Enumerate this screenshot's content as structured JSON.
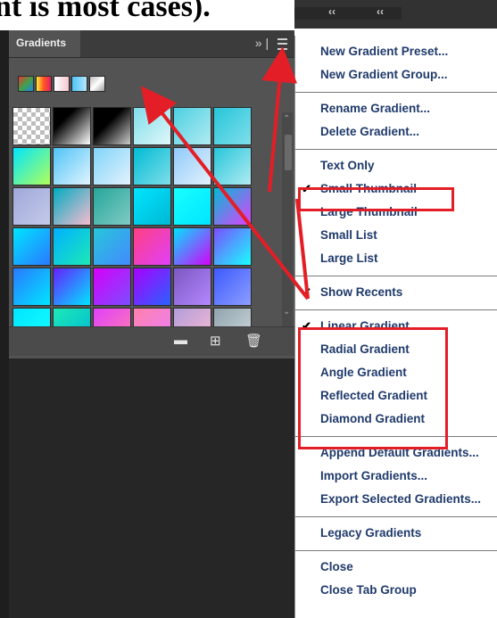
{
  "caption": "nt is most cases).",
  "panel": {
    "tab_label": "Gradients",
    "expand_glyph": "»",
    "divider_glyph": "|",
    "recents": [
      "linear-gradient(135deg,#e53935,#43a047,#1e88e5)",
      "linear-gradient(90deg,#ffeb3b,#ff5722,#e91e63)",
      "linear-gradient(90deg,#ffffff,#f5c6d0)",
      "linear-gradient(90deg,#4fc3f7,#b3e5fc)",
      "linear-gradient(135deg,#bdbdbd,#ffffff,#9e9e9e)"
    ],
    "swatches": [
      "repeating-conic-gradient(#bdbdbd 0 25%, #ffffff 0 50%) 0 0/10px 10px",
      "linear-gradient(135deg,#000 30%,#fff)",
      "linear-gradient(135deg,#000 40%,#ccc)",
      "linear-gradient(135deg,#80deea,#e0f7fa)",
      "linear-gradient(135deg,#4dd0e1,#b2ebf2)",
      "linear-gradient(135deg,#26c6da,#80deea)",
      "linear-gradient(135deg,#00e5ff,#b2ff59)",
      "linear-gradient(135deg,#4fc3f7,#e1f5fe)",
      "linear-gradient(135deg,#81d4fa,#e3f2fd)",
      "linear-gradient(135deg,#00bcd4,#80deea)",
      "linear-gradient(135deg,#90caf9,#e3f2fd)",
      "linear-gradient(135deg,#26c6da,#b2ebf2)",
      "linear-gradient(135deg,#9fa8da,#c5cae9)",
      "linear-gradient(135deg,#00acc1,#f8bbd0)",
      "linear-gradient(135deg,#26a69a,#80cbc4)",
      "linear-gradient(135deg,#00e5ff,#00b8d4)",
      "linear-gradient(135deg,#18ffff,#00e5ff)",
      "linear-gradient(135deg,#00bcd4,#e040fb)",
      "linear-gradient(135deg,#00e5ff,#2979ff)",
      "linear-gradient(135deg,#00b0ff,#1de9b6)",
      "linear-gradient(135deg,#26c6da,#448aff)",
      "linear-gradient(135deg,#ff4081,#e040fb)",
      "linear-gradient(135deg,#00e5ff,#d500f9)",
      "linear-gradient(135deg,#7c4dff,#18ffff)",
      "linear-gradient(135deg,#2979ff,#00e5ff)",
      "linear-gradient(135deg,#651fff,#00e5ff)",
      "linear-gradient(135deg,#d500f9,#7c4dff)",
      "linear-gradient(135deg,#aa00ff,#2962ff)",
      "linear-gradient(135deg,#7e57c2,#b388ff)",
      "linear-gradient(135deg,#3d5afe,#8c9eff)",
      "linear-gradient(135deg,#00e5ff,#18ffff)",
      "linear-gradient(135deg,#1de9b6,#00b8d4)",
      "linear-gradient(135deg,#e040fb,#ff80ab)",
      "linear-gradient(135deg,#ff80ab,#ea80fc)",
      "linear-gradient(135deg,#b39ddb,#f8bbd0)",
      "linear-gradient(135deg,#90a4ae,#cfd8dc)"
    ],
    "footer_icons": [
      "folder-icon",
      "new-gradient-icon",
      "trash-icon"
    ]
  },
  "collapse": {
    "glyph": "‹‹"
  },
  "menu": {
    "items": [
      {
        "label": "New Gradient Preset...",
        "checked": false
      },
      {
        "label": "New Gradient Group...",
        "checked": false
      },
      {
        "sep": true
      },
      {
        "label": "Rename Gradient...",
        "checked": false
      },
      {
        "label": "Delete Gradient...",
        "checked": false
      },
      {
        "sep": true
      },
      {
        "label": "Text Only",
        "checked": false
      },
      {
        "label": "Small Thumbnail",
        "checked": true
      },
      {
        "label": "Large Thumbnail",
        "checked": false
      },
      {
        "label": "Small List",
        "checked": false
      },
      {
        "label": "Large List",
        "checked": false
      },
      {
        "sep": true
      },
      {
        "label": "Show Recents",
        "checked": true
      },
      {
        "sep": true
      },
      {
        "label": "Linear Gradient",
        "checked": true
      },
      {
        "label": "Radial Gradient",
        "checked": false
      },
      {
        "label": "Angle Gradient",
        "checked": false
      },
      {
        "label": "Reflected Gradient",
        "checked": false
      },
      {
        "label": "Diamond Gradient",
        "checked": false
      },
      {
        "sep": true
      },
      {
        "label": "Append Default Gradients...",
        "checked": false
      },
      {
        "label": "Import Gradients...",
        "checked": false
      },
      {
        "label": "Export Selected Gradients...",
        "checked": false
      },
      {
        "sep": true
      },
      {
        "label": "Legacy Gradients",
        "checked": false
      },
      {
        "sep": true
      },
      {
        "label": "Close",
        "checked": false
      },
      {
        "label": "Close Tab Group",
        "checked": false
      }
    ]
  },
  "colors": {
    "annotation": "#e41e26",
    "menu_text": "#1f3a6b"
  }
}
